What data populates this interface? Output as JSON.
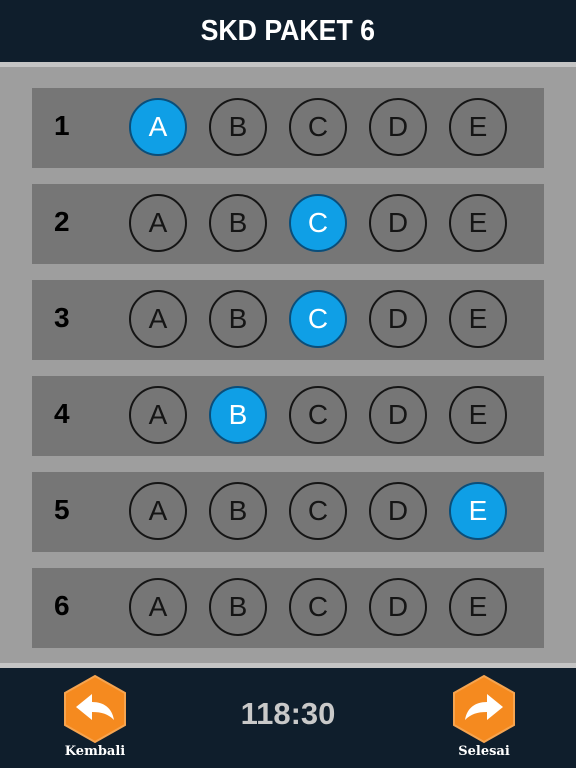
{
  "header": {
    "title": "SKD PAKET 6"
  },
  "colors": {
    "selected": "#0f9fe6",
    "header_bg": "#0f1e2c",
    "nav_button": "#f58a1f"
  },
  "questions": [
    {
      "number": "1",
      "options": [
        "A",
        "B",
        "C",
        "D",
        "E"
      ],
      "selected": "A"
    },
    {
      "number": "2",
      "options": [
        "A",
        "B",
        "C",
        "D",
        "E"
      ],
      "selected": "C"
    },
    {
      "number": "3",
      "options": [
        "A",
        "B",
        "C",
        "D",
        "E"
      ],
      "selected": "C"
    },
    {
      "number": "4",
      "options": [
        "A",
        "B",
        "C",
        "D",
        "E"
      ],
      "selected": "B"
    },
    {
      "number": "5",
      "options": [
        "A",
        "B",
        "C",
        "D",
        "E"
      ],
      "selected": "E"
    },
    {
      "number": "6",
      "options": [
        "A",
        "B",
        "C",
        "D",
        "E"
      ],
      "selected": null
    }
  ],
  "footer": {
    "back_label": "Kembali",
    "back_icon": "back-arrow-icon",
    "timer": "118:30",
    "finish_label": "Selesai",
    "finish_icon": "forward-arrow-icon"
  }
}
